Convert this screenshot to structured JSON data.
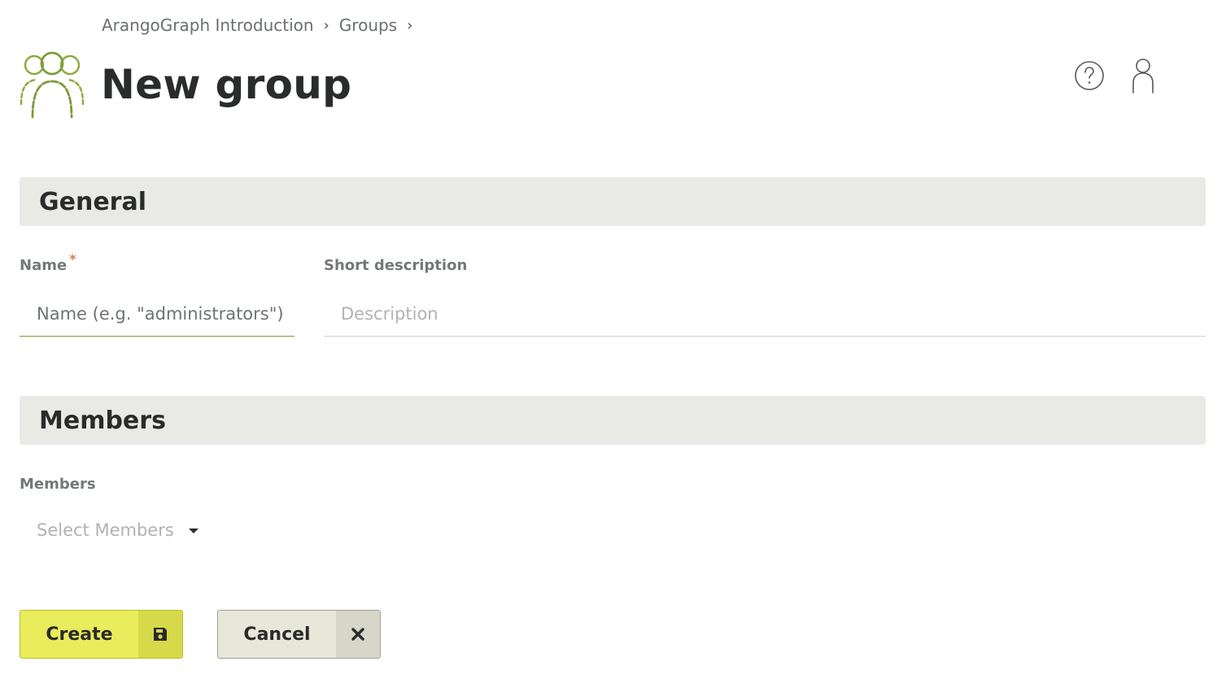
{
  "breadcrumb": {
    "items": [
      "ArangoGraph Introduction",
      "Groups"
    ],
    "separator": "›"
  },
  "page": {
    "title": "New group",
    "icon": "group-icon"
  },
  "header_actions": {
    "help_icon": "help-circle-icon",
    "user_icon": "user-icon"
  },
  "sections": {
    "general": "General",
    "members": "Members"
  },
  "form": {
    "name": {
      "label": "Name",
      "required_marker": "*",
      "placeholder": "Name (e.g. \"administrators\")",
      "value": ""
    },
    "description": {
      "label": "Short description",
      "placeholder": "Description",
      "value": ""
    },
    "members": {
      "label": "Members",
      "placeholder": "Select Members"
    }
  },
  "buttons": {
    "create": {
      "label": "Create",
      "icon": "save-icon"
    },
    "cancel": {
      "label": "Cancel",
      "icon": "close-icon"
    }
  },
  "colors": {
    "accent": "#8caa3c",
    "create_button": "#e9ec5c",
    "cancel_button": "#e7e7da",
    "section_bg": "#e9eae5",
    "required": "#e27a4e"
  }
}
